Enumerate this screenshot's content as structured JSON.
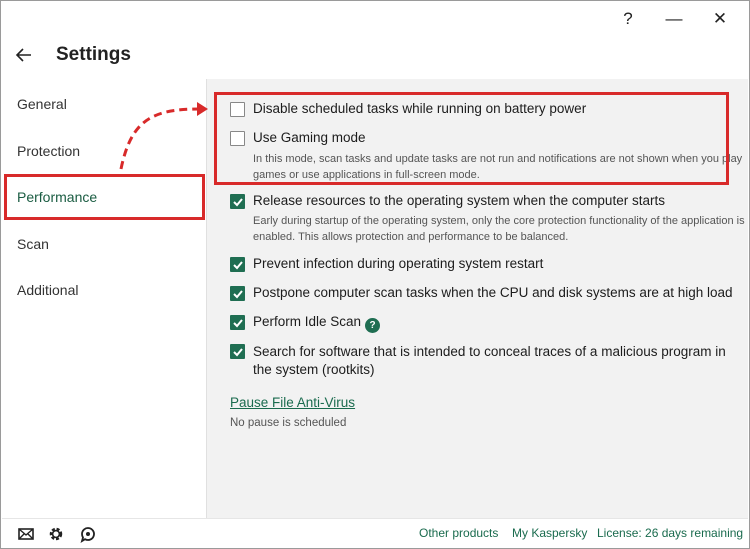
{
  "window": {
    "help_label": "?",
    "minimize_label": "—",
    "close_label": "✕"
  },
  "header": {
    "title": "Settings"
  },
  "sidebar": {
    "items": [
      {
        "label": "General"
      },
      {
        "label": "Protection"
      },
      {
        "label": "Performance",
        "active": true
      },
      {
        "label": "Scan"
      },
      {
        "label": "Additional"
      }
    ]
  },
  "options": [
    {
      "label": "Disable scheduled tasks while running on battery power",
      "checked": false
    },
    {
      "label": "Use Gaming mode",
      "checked": false,
      "description": "In this mode, scan tasks and update tasks are not run and notifications are not shown when you play games or use applications in full-screen mode."
    },
    {
      "label": "Release resources to the operating system when the computer starts",
      "checked": true,
      "description": "Early during startup of the operating system, only the core protection functionality of the application is enabled. This allows protection and performance to be balanced."
    },
    {
      "label": "Prevent infection during operating system restart",
      "checked": true
    },
    {
      "label": "Postpone computer scan tasks when the CPU and disk systems are at high load",
      "checked": true
    },
    {
      "label": "Perform Idle Scan",
      "checked": true,
      "help": "?"
    },
    {
      "label": "Search for software that is intended to conceal traces of a malicious program in the system (rootkits)",
      "checked": true
    }
  ],
  "pause": {
    "link": "Pause File Anti-Virus",
    "status": "No pause is scheduled"
  },
  "footer": {
    "other_products": "Other products",
    "my_kaspersky": "My Kaspersky",
    "license": "License: 26 days remaining",
    "icons": [
      "mail-icon",
      "gear-icon",
      "support-icon"
    ]
  },
  "colors": {
    "accent": "#1f6e52",
    "link": "#1a6b4e",
    "highlight": "#d82a2a",
    "content_bg": "#f2f2f2"
  }
}
